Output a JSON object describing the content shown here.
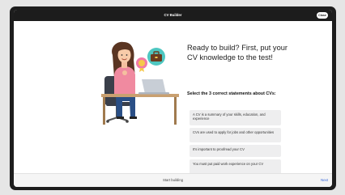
{
  "app": {
    "title": "CV Builder",
    "close_label": "Close"
  },
  "intro": {
    "heading": "Ready to build? First, put your CV knowledge to the test!",
    "question": "Select the 3 correct statements about CVs:"
  },
  "options": [
    {
      "label": "A CV is a summary of your skills, education, and experience"
    },
    {
      "label": "CVs are used to apply for jobs and other opportunities"
    },
    {
      "label": "It's important to proofread your CV"
    },
    {
      "label": "You must put paid work experience on your CV"
    }
  ],
  "footer": {
    "progress_label": "Start building",
    "next_label": "Next"
  },
  "colors": {
    "topbar": "#1c1c1c",
    "option_bg": "#eeeeef",
    "accent_link": "#2d5fd8",
    "badge_teal": "#4ec7c1",
    "badge_pink": "#f27aa6",
    "shirt": "#f08aa0"
  },
  "icons": [
    "briefcase-icon",
    "medal-icon"
  ]
}
